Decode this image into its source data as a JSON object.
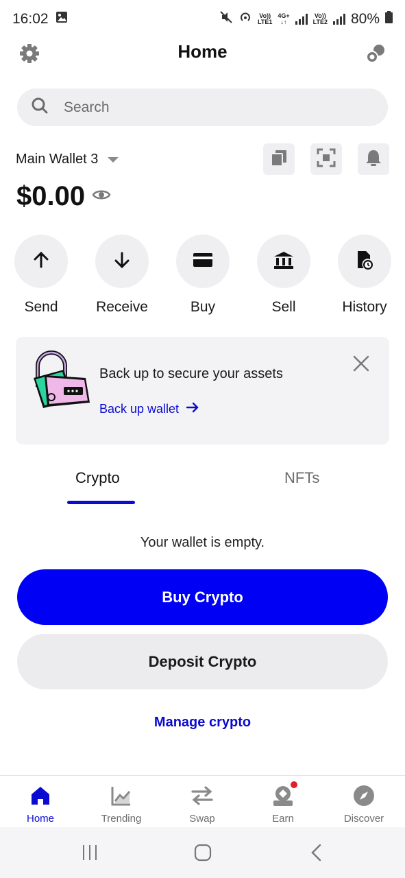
{
  "status": {
    "time": "16:02",
    "net1_top": "Vo))",
    "net1_bot": "LTE1",
    "net_mid_top": "4G+",
    "net_mid_bot": "↓↑",
    "net2_top": "Vo))",
    "net2_bot": "LTE2",
    "battery": "80%"
  },
  "header": {
    "title": "Home"
  },
  "search": {
    "placeholder": "Search"
  },
  "wallet": {
    "name": "Main Wallet 3",
    "balance": "$0.00"
  },
  "actions": [
    {
      "label": "Send"
    },
    {
      "label": "Receive"
    },
    {
      "label": "Buy"
    },
    {
      "label": "Sell"
    },
    {
      "label": "History"
    }
  ],
  "backup_card": {
    "title": "Back up to secure your assets",
    "link": "Back up wallet"
  },
  "tabs": [
    {
      "label": "Crypto",
      "active": true
    },
    {
      "label": "NFTs",
      "active": false
    }
  ],
  "empty_state": {
    "message": "Your wallet is empty.",
    "primary_button": "Buy Crypto",
    "secondary_button": "Deposit Crypto",
    "link": "Manage crypto"
  },
  "bottom_nav": [
    {
      "label": "Home",
      "icon": "home-icon",
      "active": true
    },
    {
      "label": "Trending",
      "icon": "chart-icon",
      "active": false
    },
    {
      "label": "Swap",
      "icon": "swap-icon",
      "active": false
    },
    {
      "label": "Earn",
      "icon": "earn-icon",
      "active": false
    },
    {
      "label": "Discover",
      "icon": "compass-icon",
      "active": false
    }
  ],
  "colors": {
    "accent": "#0a0ad0",
    "primary_button": "#0000f5",
    "surface": "#efeff1",
    "notification_dot": "#e0202a"
  }
}
